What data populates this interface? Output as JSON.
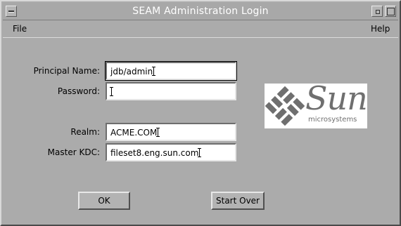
{
  "window": {
    "title": "SEAM Administration Login"
  },
  "menubar": {
    "file": "File",
    "help": "Help"
  },
  "form": {
    "principal_label": "Principal Name:",
    "principal_value": "jdb/admin",
    "password_label": "Password:",
    "password_value": "",
    "realm_label": "Realm:",
    "realm_value": "ACME.COM",
    "kdc_label": "Master KDC:",
    "kdc_value": "fileset8.eng.sun.com"
  },
  "logo": {
    "word": "Sun",
    "sub": "microsystems"
  },
  "buttons": {
    "ok": "OK",
    "start_over": "Start Over"
  }
}
